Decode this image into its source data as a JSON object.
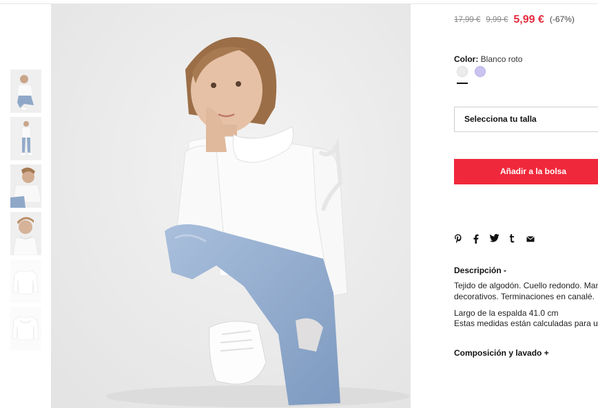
{
  "product": {
    "price_original": "17,99 €",
    "price_previous": "9,99 €",
    "price_current": "5,99 €",
    "discount": "(-67%)",
    "color_label": "Color:",
    "color_value": "Blanco roto",
    "colors": [
      "#ececec",
      "#c9c4ef"
    ],
    "size_select": "Selecciona tu talla",
    "add_to_bag": "Añadir a la bolsa",
    "description_title": "Descripción -",
    "description_lines": [
      "Tejido de algodón. Cuello redondo. Man",
      "decorativos. Terminaciones en canalé."
    ],
    "measure_lines": [
      "Largo de la espalda 41.0 cm",
      "Estas medidas están calculadas para un"
    ],
    "composition_title": "Composición y lavado +"
  },
  "share_icons": [
    "pinterest-icon",
    "facebook-icon",
    "twitter-icon",
    "tumblr-icon",
    "mail-icon"
  ],
  "accent_color": "#f0283b",
  "sale_price_color": "#e32b3e"
}
